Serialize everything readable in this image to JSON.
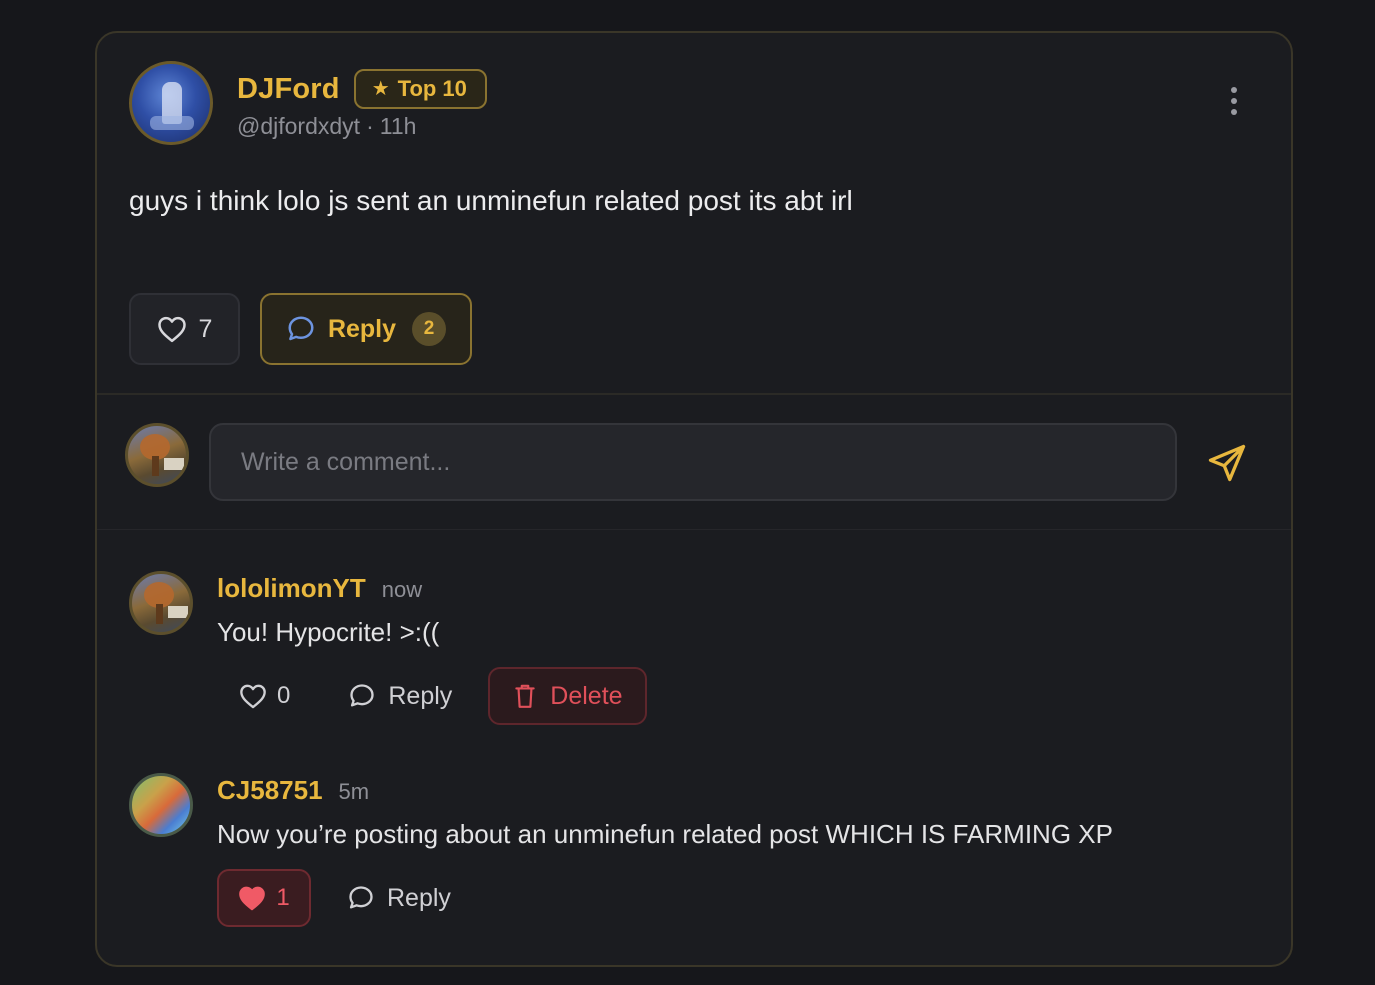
{
  "post": {
    "author": "DJFord",
    "badge": "Top 10",
    "badge_icon": "star-icon",
    "handle": "@djfordxdyt",
    "separator": "·",
    "time": "11h",
    "text": "guys i think lolo js sent an unminefun related post its abt irl",
    "likes": "7",
    "reply_label": "Reply",
    "reply_count": "2"
  },
  "composer": {
    "placeholder": "Write a comment..."
  },
  "comments": [
    {
      "author": "lololimonYT",
      "time": "now",
      "text": "You! Hypocrite! >:((",
      "likes": "0",
      "liked": false,
      "reply_label": "Reply",
      "delete_label": "Delete"
    },
    {
      "author": "CJ58751",
      "time": "5m",
      "text": "Now you’re posting about an unminefun related post WHICH IS FARMING XP",
      "likes": "1",
      "liked": true,
      "reply_label": "Reply"
    }
  ],
  "colors": {
    "accent": "#e8b73e",
    "background": "#16171b",
    "card": "#1b1c20",
    "danger": "#e0505a",
    "liked": "#f05a66"
  }
}
